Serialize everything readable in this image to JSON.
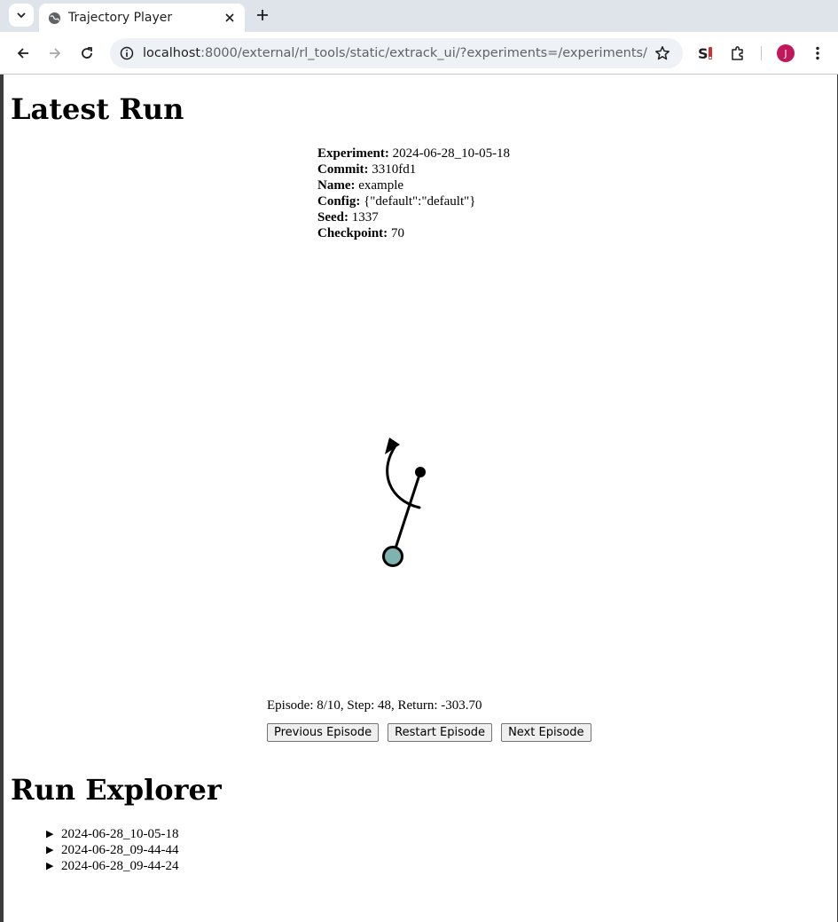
{
  "browser": {
    "tab_title": "Trajectory Player",
    "url_host": "localhost",
    "url_rest": ":8000/external/rl_tools/static/extrack_ui/?experiments=/experiments/",
    "avatar_initial": "J"
  },
  "latest_run": {
    "heading": "Latest Run",
    "fields": {
      "experiment_label": "Experiment:",
      "experiment": "2024-06-28_10-05-18",
      "commit_label": "Commit:",
      "commit": "3310fd1",
      "name_label": "Name:",
      "name": "example",
      "config_label": "Config:",
      "config": "{\"default\":\"default\"}",
      "seed_label": "Seed:",
      "seed": "1337",
      "checkpoint_label": "Checkpoint:",
      "checkpoint": "70"
    },
    "status": "Episode: 8/10, Step: 48, Return: -303.70",
    "buttons": {
      "previous": "Previous Episode",
      "restart": "Restart Episode",
      "next": "Next Episode"
    },
    "pendulum": {
      "pivot_color": "#7fb3b0",
      "rod_color": "#000000"
    }
  },
  "run_explorer": {
    "heading": "Run Explorer",
    "items": [
      "2024-06-28_10-05-18",
      "2024-06-28_09-44-44",
      "2024-06-28_09-44-24"
    ]
  }
}
